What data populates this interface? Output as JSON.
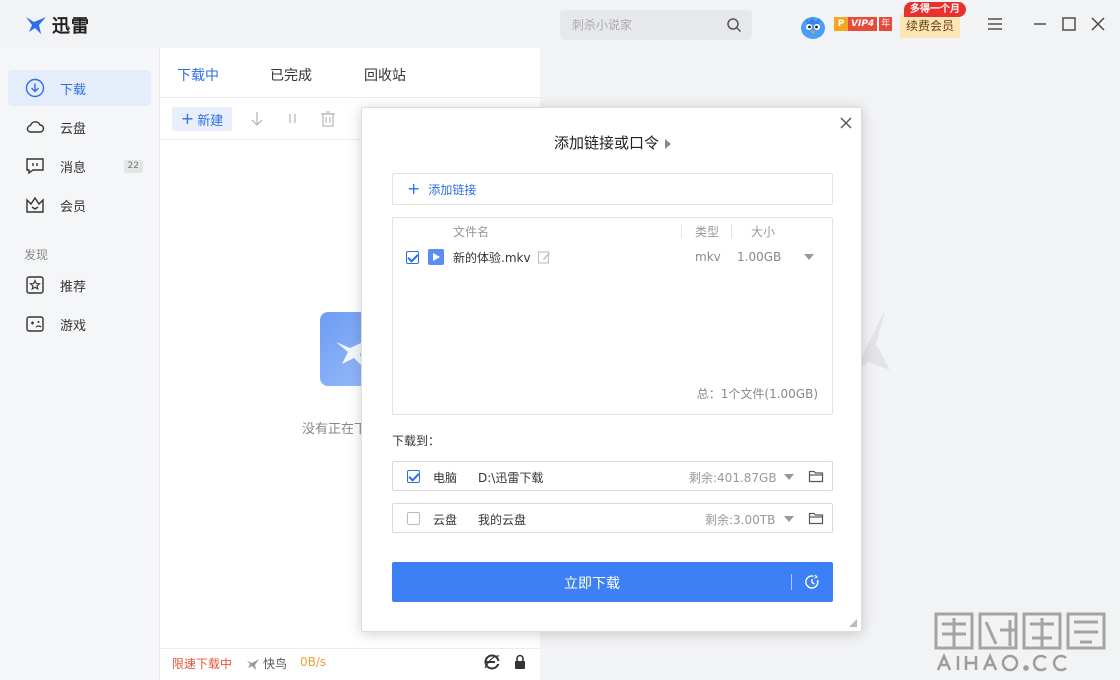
{
  "app": {
    "title": "迅雷",
    "search_placeholder": "刺杀小说家",
    "vip_p": "P",
    "vip_level": "VIP4",
    "vip_year": "年",
    "promo": "多得一个月",
    "renew_label": "续费会员"
  },
  "sidebar": {
    "items": [
      {
        "label": "下载",
        "icon": "download-icon"
      },
      {
        "label": "云盘",
        "icon": "cloud-icon"
      },
      {
        "label": "消息",
        "icon": "message-icon",
        "count": "22"
      },
      {
        "label": "会员",
        "icon": "crown-icon"
      }
    ],
    "section_label": "发现",
    "discover": [
      {
        "label": "推荐",
        "icon": "star-icon"
      },
      {
        "label": "游戏",
        "icon": "gamepad-icon"
      }
    ]
  },
  "main": {
    "tabs": [
      "下载中",
      "已完成",
      "回收站"
    ],
    "new_label": "新建",
    "empty_text": "没有正在下",
    "status": {
      "limit": "限速下载中",
      "bird": "快鸟",
      "speed": "0B/s"
    }
  },
  "dialog": {
    "title": "添加链接或口令",
    "add_link": "添加链接",
    "headers": {
      "name": "文件名",
      "type": "类型",
      "size": "大小"
    },
    "files": [
      {
        "name": "新的体验.mkv",
        "type": "mkv",
        "size": "1.00GB",
        "checked": true
      }
    ],
    "total": "总：1个文件(1.00GB)",
    "save_to": "下载到：",
    "destinations": [
      {
        "name": "电脑",
        "path": "D:\\迅雷下载",
        "free": "剩余:401.87GB",
        "checked": true
      },
      {
        "name": "云盘",
        "path": "我的云盘",
        "free": "剩余:3.00TB",
        "checked": false
      }
    ],
    "download_button": "立即下载"
  },
  "colors": {
    "accent": "#3d80f5",
    "active_tab": "#2d6fe8",
    "limit_text": "#e8553a",
    "speed_text": "#e8a03a"
  }
}
